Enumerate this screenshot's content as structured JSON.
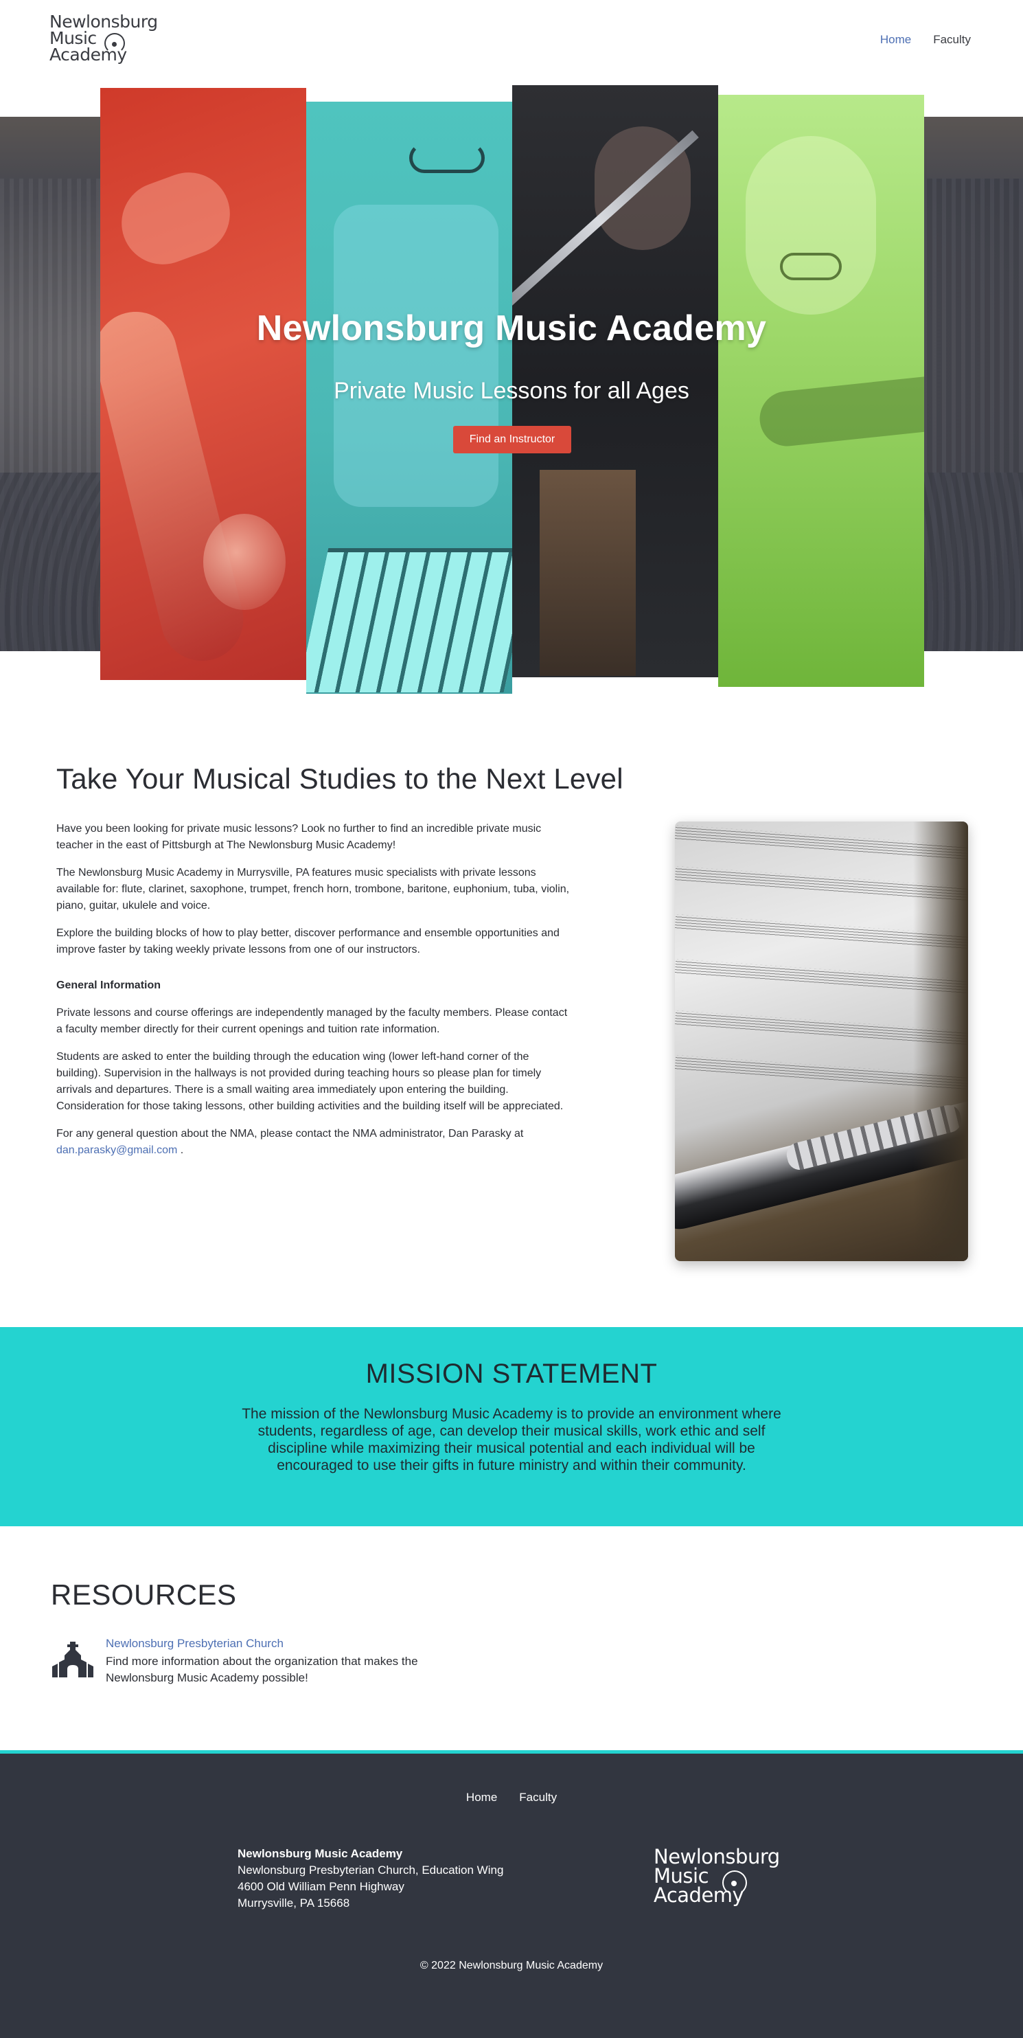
{
  "header": {
    "logo_lines": [
      "Newlonsburg",
      "Music",
      "Academy"
    ],
    "nav": [
      {
        "label": "Home",
        "active": true
      },
      {
        "label": "Faculty",
        "active": false
      }
    ]
  },
  "hero": {
    "title": "Newlonsburg Music Academy",
    "subtitle": "Private Music Lessons for all Ages",
    "cta_label": "Find an Instructor",
    "panel_colors": [
      "#d9493a",
      "#4fc4bf",
      "#1f2024",
      "#9ed86a"
    ]
  },
  "intro": {
    "title": "Take Your Musical Studies to the Next Level",
    "p1": "Have you been looking for private music lessons? Look no further to find an incredible private music teacher in the east of Pittsburgh at The Newlonsburg Music Academy!",
    "p2": "The Newlonsburg Music Academy in Murrysville, PA features music specialists with private lessons available for: flute, clarinet, saxophone, trumpet, french horn, trombone, baritone, euphonium, tuba, violin, piano, guitar, ukulele and voice.",
    "p3": "Explore the building blocks of how to play better, discover performance and ensemble opportunities and improve faster by taking weekly private lessons from one of our instructors.",
    "general_heading": "General Information",
    "p4": "Private lessons and course offerings are independently managed by the faculty members. Please contact a faculty member directly for their current openings and tuition rate information.",
    "p5": "Students are asked to enter the building through the education wing (lower left-hand corner of the building). Supervision in the hallways is not provided during teaching hours so please plan for timely arrivals and departures. There is a small waiting area immediately upon entering the building. Consideration for those taking lessons, other building activities and the building itself will be appreciated.",
    "p6_before": "For any general question about the NMA, please contact the NMA administrator, Dan Parasky at",
    "p6_email": "dan.parasky@gmail.com",
    "p6_after": "."
  },
  "mission": {
    "title": "MISSION STATEMENT",
    "text": "The mission of the Newlonsburg Music Academy is to provide an environment where students, regardless of age, can develop their musical skills, work ethic and self discipline while maximizing their musical potential and each individual will be encouraged to use their gifts in future ministry and within their community."
  },
  "resources": {
    "title": "RESOURCES",
    "items": [
      {
        "icon": "church-icon",
        "link_label": "Newlonsburg Presbyterian Church",
        "description": "Find more information about the organization that makes the Newlonsburg Music Academy possible!"
      }
    ]
  },
  "footer": {
    "nav": [
      "Home",
      "Faculty"
    ],
    "address": {
      "name": "Newlonsburg Music Academy",
      "line1": "Newlonsburg Presbyterian Church, Education Wing",
      "line2": "4600 Old William Penn Highway",
      "line3": "Murrysville, PA 15668"
    },
    "logo_lines": [
      "Newlonsburg",
      "Music",
      "Academy"
    ],
    "copyright": "© 2022 Newlonsburg Music Academy"
  },
  "colors": {
    "accent_link": "#4d6fb3",
    "mission_bg": "#24d3d0",
    "footer_bg": "#323640",
    "cta_bg": "#d9493a"
  }
}
